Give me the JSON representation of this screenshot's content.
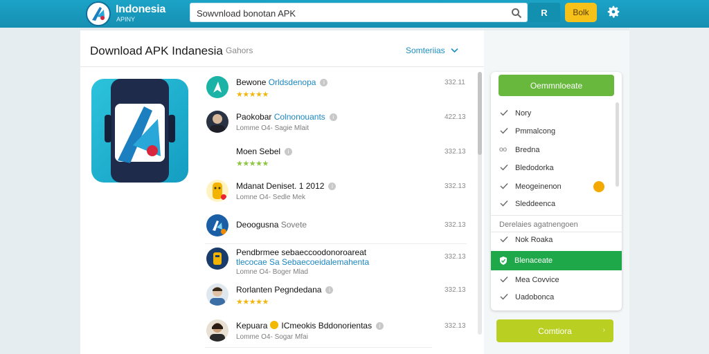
{
  "header": {
    "brand": "Indonesia",
    "brand_sub": "APINY",
    "search_value": "Sowvnload bonotan APK",
    "btn_r_label": "R",
    "btn_y_label": "Bolk"
  },
  "panel": {
    "title": "Download APK Indanesia",
    "title_sub": "Gahors",
    "sort_label": "Somteriias"
  },
  "list": [
    {
      "title": "Bewone",
      "highlight": "Orldsdenopa",
      "meta": "",
      "stars": "★★★★★",
      "num": "332.11"
    },
    {
      "title": "Paokobar",
      "highlight": "Colnonouants",
      "meta": "Lomme O4- Sagie Mlait",
      "stars": "",
      "num": "422.13"
    },
    {
      "title": "Moen Sebel",
      "highlight": "",
      "meta": "",
      "stars": "★★★★★",
      "num": "332.13"
    },
    {
      "title": "Mdanat Deniset. 1 2012",
      "highlight": "",
      "meta": "Lomne O4- Sedle Mek",
      "stars": "",
      "num": "332.13"
    },
    {
      "title": "Deoogusna",
      "highlight": "Sovete",
      "meta": "",
      "stars": "",
      "num": "332.13"
    },
    {
      "title": "Pendbrmee sebaeccoodonoroareat",
      "highlight": "tlecocae Sa Sebaecoeidalemahenta",
      "meta": "Lomne O4- Boger Mlad",
      "stars": "★★★★★",
      "num": "332.13"
    },
    {
      "title": "Rorlanten Pegndedana",
      "highlight": "",
      "meta": "",
      "stars": "★★★★★",
      "num": "332.13"
    },
    {
      "title": "Kepuara",
      "highlight": "ICmeokis Bddonorientas",
      "meta": "Lomme O4- Sogar Mfai",
      "stars": "",
      "num": "332.13"
    }
  ],
  "dropdown": {
    "button": "Oemmnloeate",
    "items_top": [
      "Nory",
      "Pmmalcong",
      "Bredna",
      "Bledodorka",
      "Meogeinenon",
      "Sleddeenca"
    ],
    "top_marks": [
      "check",
      "check",
      "dot",
      "check",
      "check",
      "check"
    ],
    "section": "Derelaies agatnengoen",
    "items_bottom": [
      "Nok Roaka",
      "Blenaceate",
      "Mea Covvice",
      "Uadobonca"
    ],
    "selected_index": 1
  },
  "confirm_label": "Comtiora",
  "colors": {
    "topbar": "#1ba3c6",
    "accent_green": "#67b83d",
    "selected_green": "#1fa84a",
    "confirm_lime": "#b9cf22",
    "star": "#f1b60d",
    "link_blue": "#1a86c2"
  }
}
